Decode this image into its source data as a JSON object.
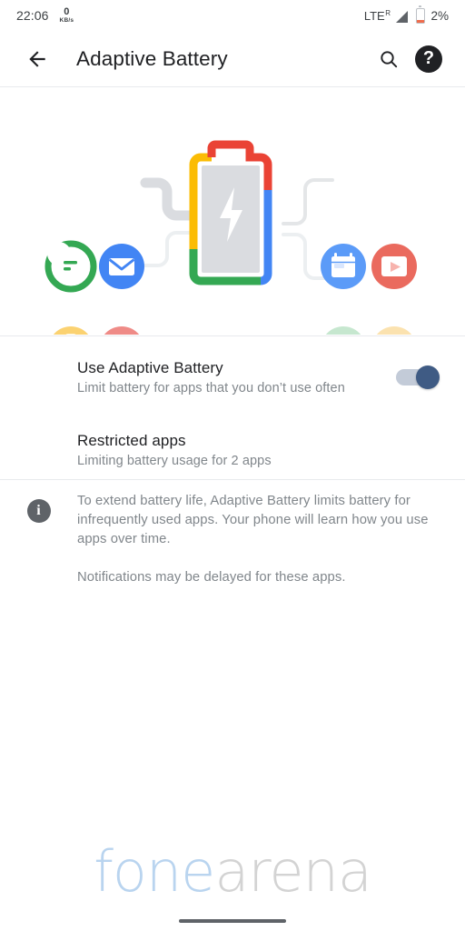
{
  "status_bar": {
    "time": "22:06",
    "net_speed_value": "0",
    "net_speed_unit": "KB/s",
    "network_type": "LTE",
    "network_roaming": "R",
    "battery_percent": "2%",
    "battery_level": 2
  },
  "appbar": {
    "back_icon": "arrow-back-icon",
    "title": "Adaptive Battery",
    "search_icon": "search-icon",
    "help_icon": "help-icon",
    "help_glyph": "?"
  },
  "illustration": {
    "name": "adaptive-battery-illustration",
    "battery_label": "battery-with-bolt",
    "apps_left": [
      {
        "name": "messages-icon",
        "color": "#34a853",
        "dimmed": false
      },
      {
        "name": "email-icon",
        "color": "#4285f4",
        "dimmed": false
      },
      {
        "name": "briefcase-icon",
        "color": "#fbd271",
        "dimmed": true
      },
      {
        "name": "fitness-run-icon",
        "color": "#ef8b87",
        "dimmed": true
      }
    ],
    "apps_right": [
      {
        "name": "calendar-icon",
        "color": "#5b9bf8",
        "dimmed": false
      },
      {
        "name": "video-play-icon",
        "color": "#ea6a5e",
        "dimmed": false
      },
      {
        "name": "maps-pin-icon",
        "color": "#c6e7cf",
        "dimmed": true
      },
      {
        "name": "photos-card-icon",
        "color": "#fbe2af",
        "dimmed": true
      }
    ]
  },
  "settings": {
    "adaptive_battery": {
      "title": "Use Adaptive Battery",
      "subtitle": "Limit battery for apps that you don’t use often",
      "toggle_on": true,
      "toggle_track_color": "#c3cbd8",
      "toggle_thumb_color": "#3f5b84"
    },
    "restricted_apps": {
      "title": "Restricted apps",
      "subtitle": "Limiting battery usage for 2 apps"
    }
  },
  "info": {
    "icon": "info-icon",
    "icon_glyph": "i",
    "paragraph_1": "To extend battery life, Adaptive Battery limits battery for infrequently used apps. Your phone will learn how you use apps over time.",
    "paragraph_2": "Notifications may be delayed for these apps."
  },
  "watermark": {
    "part_a": "fone",
    "part_b": "arena",
    "color_a": "#b9d4ef",
    "color_b": "#d3d3d3"
  },
  "nav": {
    "gesture_pill": "gesture-nav-pill"
  }
}
